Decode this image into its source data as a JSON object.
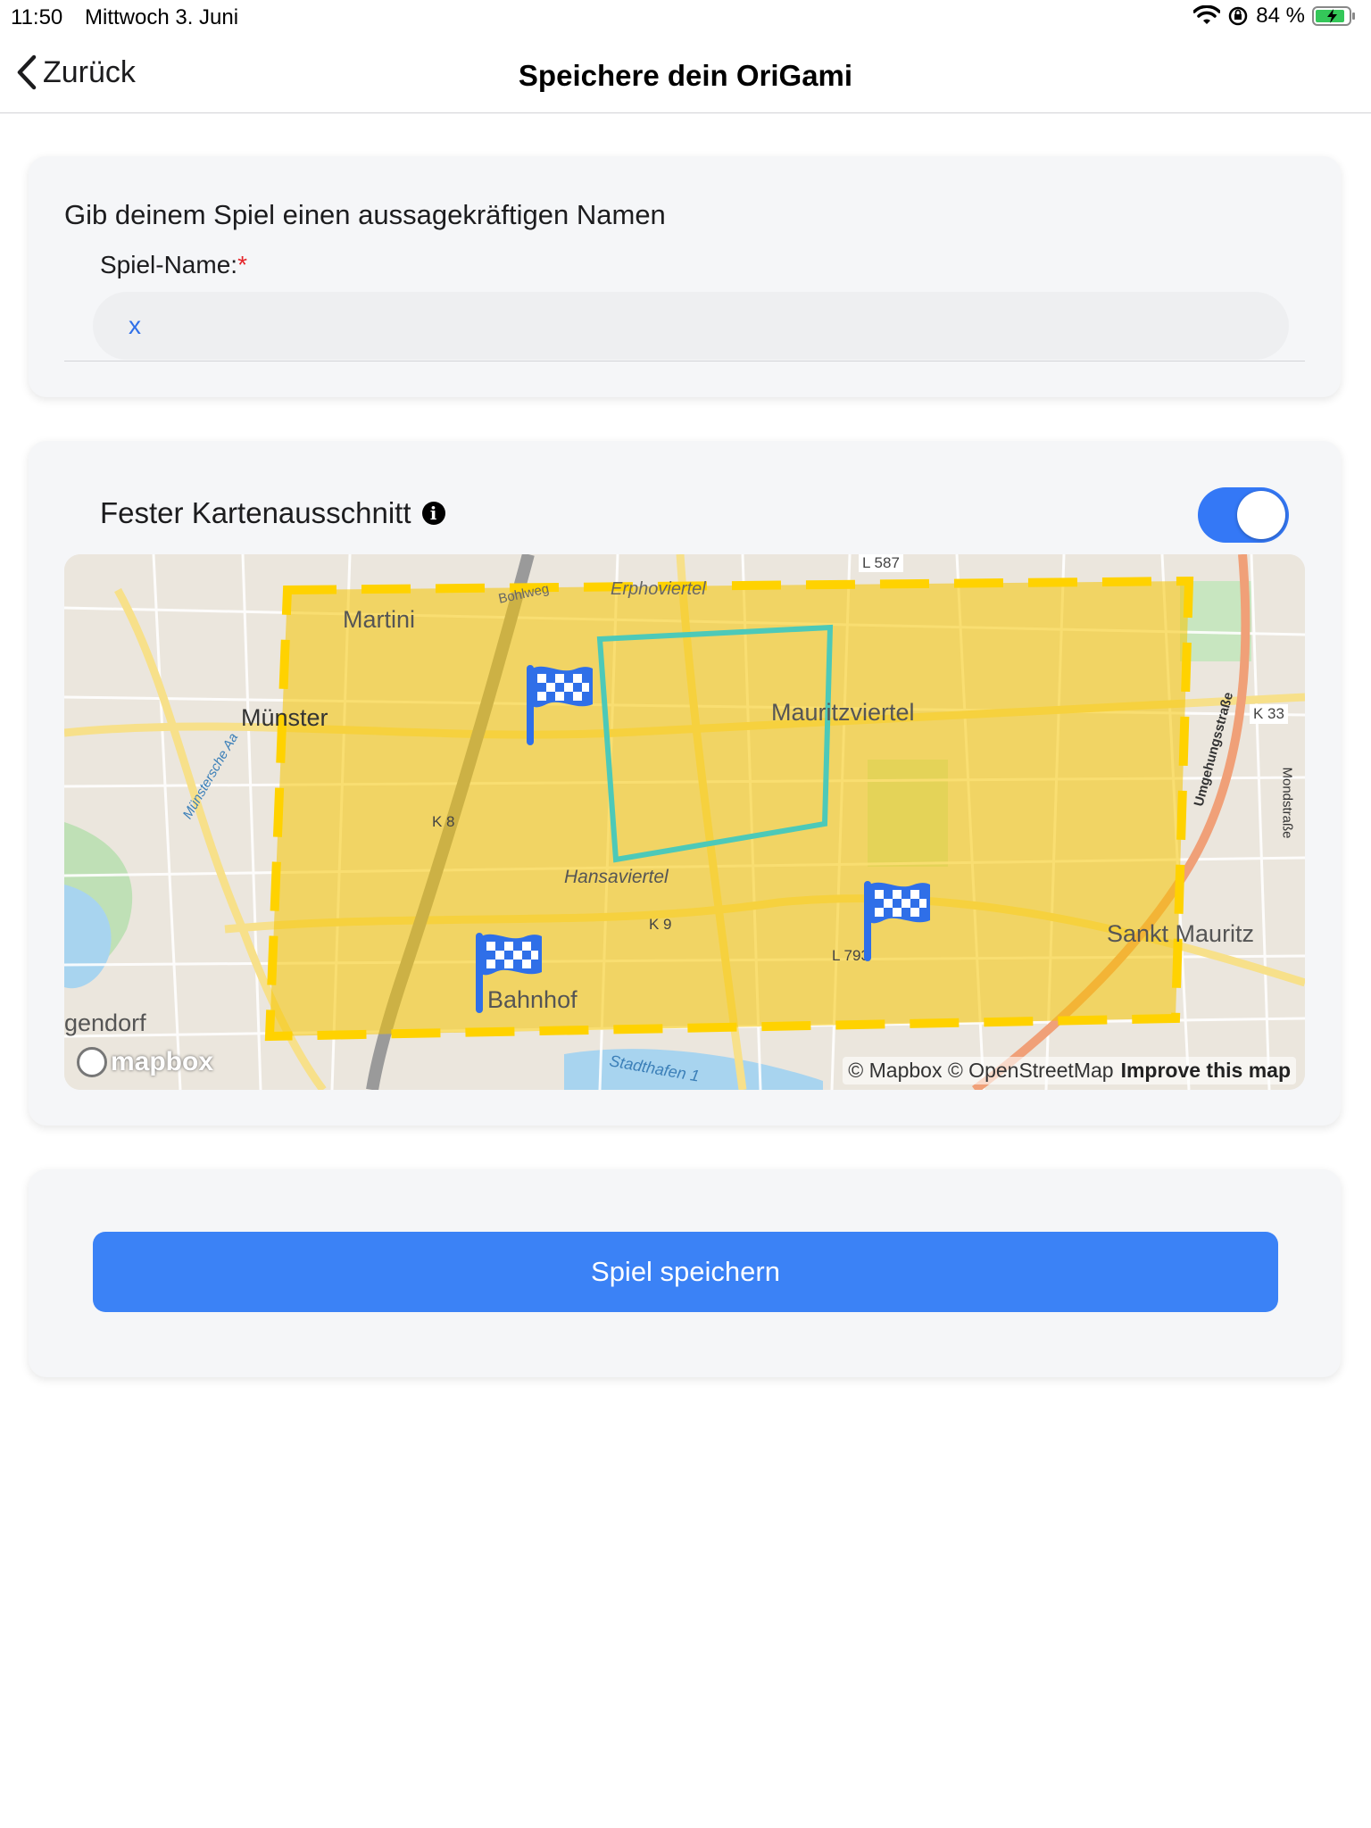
{
  "status_bar": {
    "time": "11:50",
    "date": "Mittwoch 3. Juni",
    "battery": "84 %"
  },
  "nav": {
    "back_label": "Zurück",
    "title": "Speichere dein OriGami"
  },
  "name_card": {
    "heading": "Gib deinem Spiel einen aussagekräftigen Namen",
    "label": "Spiel-Name:",
    "required_mark": "*",
    "input_value": "x"
  },
  "map_card": {
    "toggle_label": "Fester Kartenausschnitt",
    "toggle_on": true,
    "map_labels": {
      "a": "Martini",
      "b": "Münster",
      "c": "Mauritzviertel",
      "d": "Hansaviertel",
      "e": "Sankt Mauritz",
      "f": "Bahnhof",
      "g": "gendorf",
      "h": "Stadthafen 1",
      "i": "Umgehungsstraße",
      "j": "Mondstraße",
      "k": "K 33",
      "l": "K 8",
      "m": "K 9",
      "n": "L 793",
      "o": "L 587",
      "p": "Bohlweg",
      "q": "Erphoviertel",
      "r": "Münstersche Aa"
    },
    "attribution": "© Mapbox © OpenStreetMap",
    "improve_link": "Improve this map",
    "logo_text": "mapbox",
    "colors": {
      "area_fill": "#f5c400",
      "area_border": "#ffd200",
      "polygon": "#4dc9b8",
      "flag": "#2f6fe8"
    }
  },
  "save_card": {
    "button_label": "Spiel speichern"
  }
}
